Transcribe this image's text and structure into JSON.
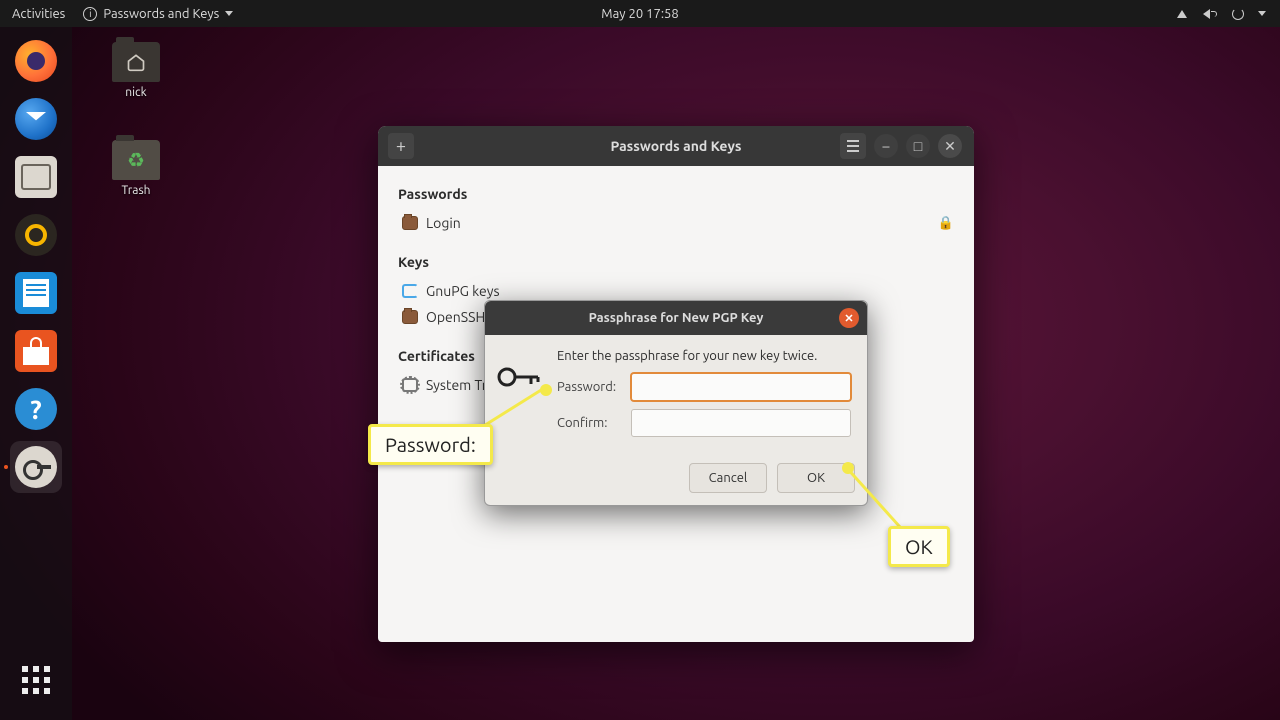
{
  "topbar": {
    "activities": "Activities",
    "app_menu": "Passwords and Keys",
    "clock": "May 20  17:58"
  },
  "desktop": {
    "home_label": "nick",
    "trash_label": "Trash"
  },
  "window": {
    "title": "Passwords and Keys",
    "sections": {
      "passwords_header": "Passwords",
      "login_item": "Login",
      "keys_header": "Keys",
      "gnupg_item": "GnuPG keys",
      "openssh_item": "OpenSSH k",
      "certs_header": "Certificates",
      "system_trust_item": "System Tru"
    }
  },
  "dialog": {
    "title": "Passphrase for New PGP Key",
    "message": "Enter the passphrase for your new key twice.",
    "password_label": "Password:",
    "confirm_label": "Confirm:",
    "cancel": "Cancel",
    "ok": "OK"
  },
  "annotations": {
    "password_callout": "Password:",
    "ok_callout": "OK"
  }
}
